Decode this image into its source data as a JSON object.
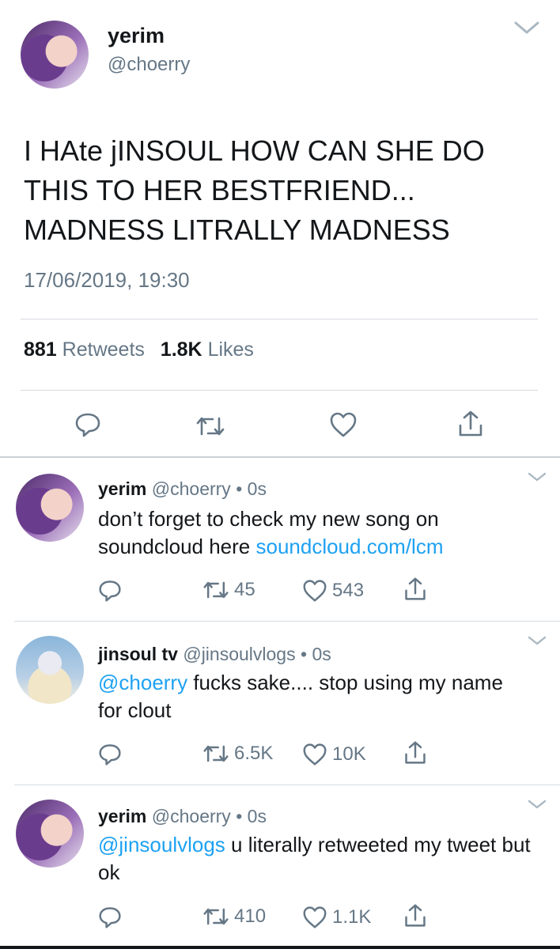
{
  "main_tweet": {
    "display_name": "yerim",
    "handle": "@choerry",
    "text": "I HAte jINSOUL HOW CAN SHE DO THIS TO HER BESTFRIEND... MADNESS LITRALLY MADNESS",
    "timestamp": "17/06/2019, 19:30",
    "retweets_count": "881",
    "retweets_label": "Retweets",
    "likes_count": "1.8K",
    "likes_label": "Likes"
  },
  "replies": [
    {
      "display_name": "yerim",
      "handle": "@choerry",
      "dot": "•",
      "time": "0s",
      "text_before": "don’t forget to check my new song on soundcloud here ",
      "link": "soundcloud.com/lcm",
      "retweets": "45",
      "likes": "543"
    },
    {
      "display_name": "jinsoul tv",
      "handle": "@jinsoulvlogs",
      "dot": "•",
      "time": "0s",
      "mention": "@choerry",
      "text_after": " fucks sake.... stop using my name for clout",
      "retweets": "6.5K",
      "likes": "10K"
    },
    {
      "display_name": "yerim",
      "handle": "@choerry",
      "dot": "•",
      "time": "0s",
      "mention": "@jinsoulvlogs",
      "text_after": " u literally retweeted my tweet but ok",
      "retweets": "410",
      "likes": "1.1K"
    }
  ],
  "icons": [
    "reply-icon",
    "retweet-icon",
    "like-icon",
    "share-icon",
    "chevron-down-icon"
  ],
  "colors": {
    "text": "#14171a",
    "muted": "#657786",
    "link": "#1da1f2",
    "divider": "#d6dbe0"
  }
}
